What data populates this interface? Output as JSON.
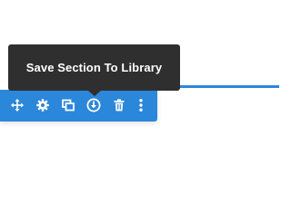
{
  "section": {
    "accent_color": "#2b87da"
  },
  "toolbar": {
    "buttons": [
      {
        "icon": "move-icon",
        "action": "move-section"
      },
      {
        "icon": "gear-icon",
        "action": "section-settings"
      },
      {
        "icon": "duplicate-icon",
        "action": "duplicate-section"
      },
      {
        "icon": "save-to-library-icon",
        "action": "save-section-to-library"
      },
      {
        "icon": "trash-icon",
        "action": "delete-section"
      },
      {
        "icon": "more-options-icon",
        "action": "more-options"
      }
    ]
  },
  "tooltip": {
    "text": "Save Section To Library",
    "background": "#2f2f2f"
  }
}
